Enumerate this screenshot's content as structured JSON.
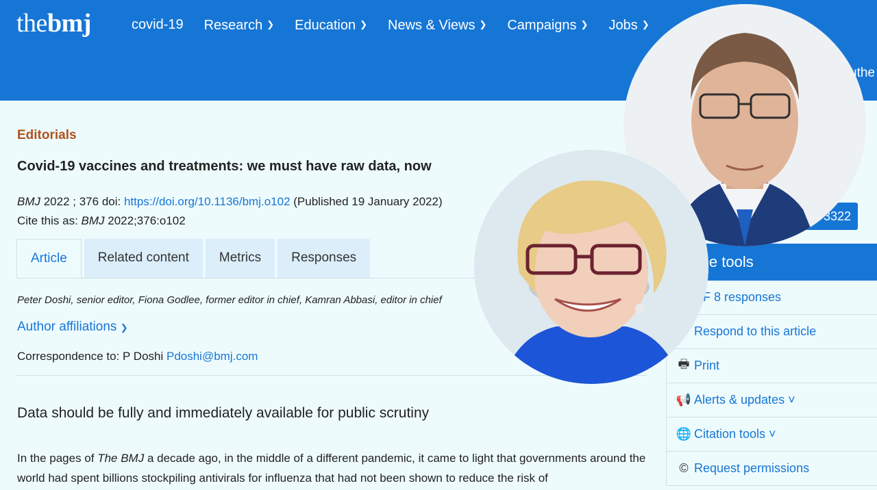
{
  "header": {
    "logo_thin": "the",
    "logo_bold": "bmj",
    "nav": [
      {
        "label": "covid-19",
        "chevron": false
      },
      {
        "label": "Research",
        "chevron": true
      },
      {
        "label": "Education",
        "chevron": true
      },
      {
        "label": "News & Views",
        "chevron": true
      },
      {
        "label": "Campaigns",
        "chevron": true
      },
      {
        "label": "Jobs",
        "chevron": true
      }
    ],
    "author_peek": "uthe"
  },
  "article": {
    "section": "Editorials",
    "title": "Covid-19 vaccines and treatments: we must have raw data, now",
    "journal": "BMJ",
    "volume": " 2022 ; 376 ",
    "doi_label": "doi: ",
    "doi_url": "https://doi.org/10.1136/bmj.o102",
    "published": " (Published 19 January 2022)",
    "cite_label": "Cite this as: ",
    "cite_journal": "BMJ",
    "cite_ref": " 2022;376:o102",
    "tabs": [
      "Article",
      "Related content",
      "Metrics",
      "Responses"
    ],
    "authors": "Peter Doshi, senior editor,  Fiona Godlee, former editor in chief,  Kamran Abbasi, editor in chief",
    "affiliations": "Author affiliations",
    "correspondence_label": "Correspondence to: P Doshi ",
    "correspondence_email": "Pdoshi@bmj.com",
    "subheading": "Data should be fully and immediately available for public scrutiny",
    "body_pre": "In the pages of ",
    "body_italic": "The BMJ",
    "body_post": " a decade ago, in the middle of a different pandemic, it came to light that governments around the world had spent billions stockpiling antivirals for influenza that had not been shown to reduce the risk of"
  },
  "sidebar": {
    "count_value": "3322",
    "tools_title": "le tools",
    "tools": [
      {
        "icon": "comment-icon",
        "glyph": "💬",
        "label": "DF    8 responses"
      },
      {
        "icon": "reply-icon",
        "glyph": "↩",
        "label": "Respond to this article"
      },
      {
        "icon": "print-icon",
        "glyph": "🖶",
        "label": "Print"
      },
      {
        "icon": "megaphone-icon",
        "glyph": "📢",
        "label": "Alerts & updates ˅"
      },
      {
        "icon": "globe-icon",
        "glyph": "🌐",
        "label": "Citation tools ˅"
      },
      {
        "icon": "copyright-icon",
        "glyph": "©",
        "label": "Request permissions"
      }
    ]
  },
  "colors": {
    "brand_blue": "#1676d6",
    "section_orange": "#b0521b",
    "page_bg": "#eefbfd"
  }
}
